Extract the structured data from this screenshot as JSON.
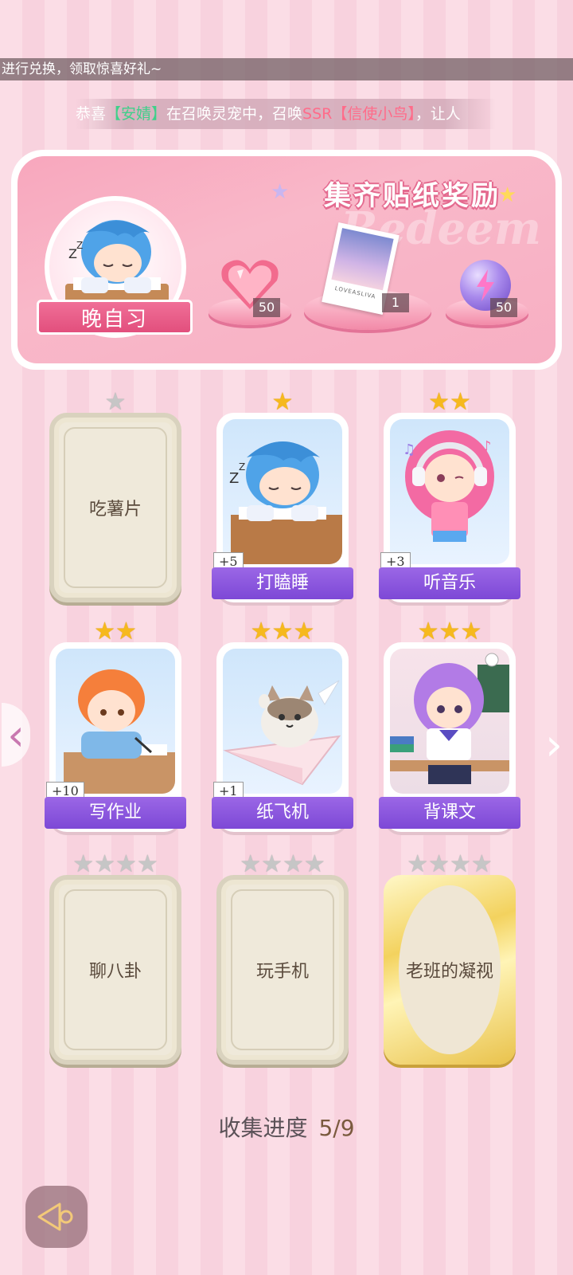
{
  "notices": {
    "top": "进行兑换，领取惊喜好礼~",
    "ticker_prefix": "恭喜",
    "ticker_user": "【安婧】",
    "ticker_mid": "在召唤灵宠中，召唤",
    "ticker_item": "SSR【信使小鸟】",
    "ticker_suffix": "，让人"
  },
  "banner": {
    "title": "集齐贴纸奖励",
    "watermark": "Redeem",
    "avatar_label": "晚自习",
    "rewards": [
      {
        "icon": "heart-gem-icon",
        "count": "50"
      },
      {
        "icon": "photo-card-icon",
        "count": "1"
      },
      {
        "icon": "energy-orb-icon",
        "count": "50"
      }
    ],
    "photo_caption": "LOVEASLIVA"
  },
  "cards": [
    {
      "label": "吃薯片",
      "stars": 1,
      "state": "locked",
      "bonus": ""
    },
    {
      "label": "打瞌睡",
      "stars": 1,
      "state": "owned",
      "bonus": "+5"
    },
    {
      "label": "听音乐",
      "stars": 2,
      "state": "owned",
      "bonus": "+3"
    },
    {
      "label": "写作业",
      "stars": 2,
      "state": "owned",
      "bonus": "+10"
    },
    {
      "label": "纸飞机",
      "stars": 3,
      "state": "owned",
      "bonus": "+1"
    },
    {
      "label": "背课文",
      "stars": 3,
      "state": "owned",
      "bonus": ""
    },
    {
      "label": "聊八卦",
      "stars": 4,
      "state": "locked",
      "bonus": ""
    },
    {
      "label": "玩手机",
      "stars": 4,
      "state": "locked",
      "bonus": ""
    },
    {
      "label": "老班的凝视",
      "stars": 4,
      "state": "locked-gold",
      "bonus": ""
    }
  ],
  "progress": {
    "label": "收集进度",
    "value": "5/9"
  },
  "colors": {
    "ribbon": "#8a55dd",
    "star_gold": "#f6b91e",
    "banner_pink": "#f8a7bd"
  }
}
